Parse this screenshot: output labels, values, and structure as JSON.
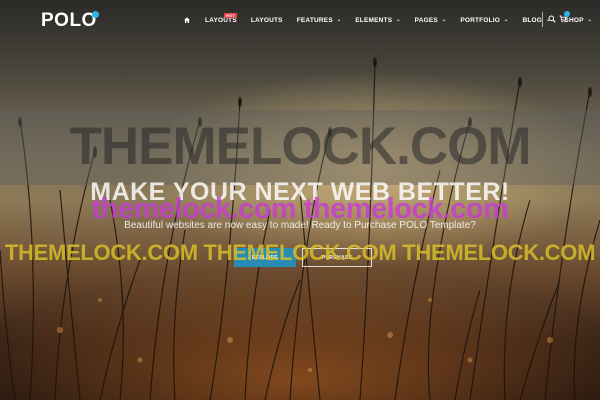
{
  "brand": {
    "name": "POLO",
    "accent_color": "#2bb6e8"
  },
  "nav": {
    "home_icon": "home-icon",
    "items": [
      {
        "label": "Layouts",
        "badge": "HOT",
        "has_dropdown": false
      },
      {
        "label": "Layouts",
        "has_dropdown": false
      },
      {
        "label": "Features",
        "has_dropdown": true
      },
      {
        "label": "Elements",
        "has_dropdown": true
      },
      {
        "label": "Pages",
        "has_dropdown": true
      },
      {
        "label": "Portfolio",
        "has_dropdown": true
      },
      {
        "label": "Blog",
        "has_dropdown": true
      },
      {
        "label": "Shop",
        "has_dropdown": true
      }
    ],
    "search_icon": "search-icon",
    "cart_icon": "cart-icon"
  },
  "hero": {
    "headline": "MAKE YOUR NEXT WEB BETTER!",
    "subtext": "Beautiful websites are now easy to made! Ready to Purchase POLO Template?",
    "primary_button": "EXPLORE",
    "secondary_button": "PURCHASE"
  },
  "watermarks": {
    "top": "THEMELOCK.COM",
    "middle": "themelock.com themelock.com",
    "bottom": "THEMELOCK.COM THEMELOCK.COM THEMELOCK.COM"
  }
}
